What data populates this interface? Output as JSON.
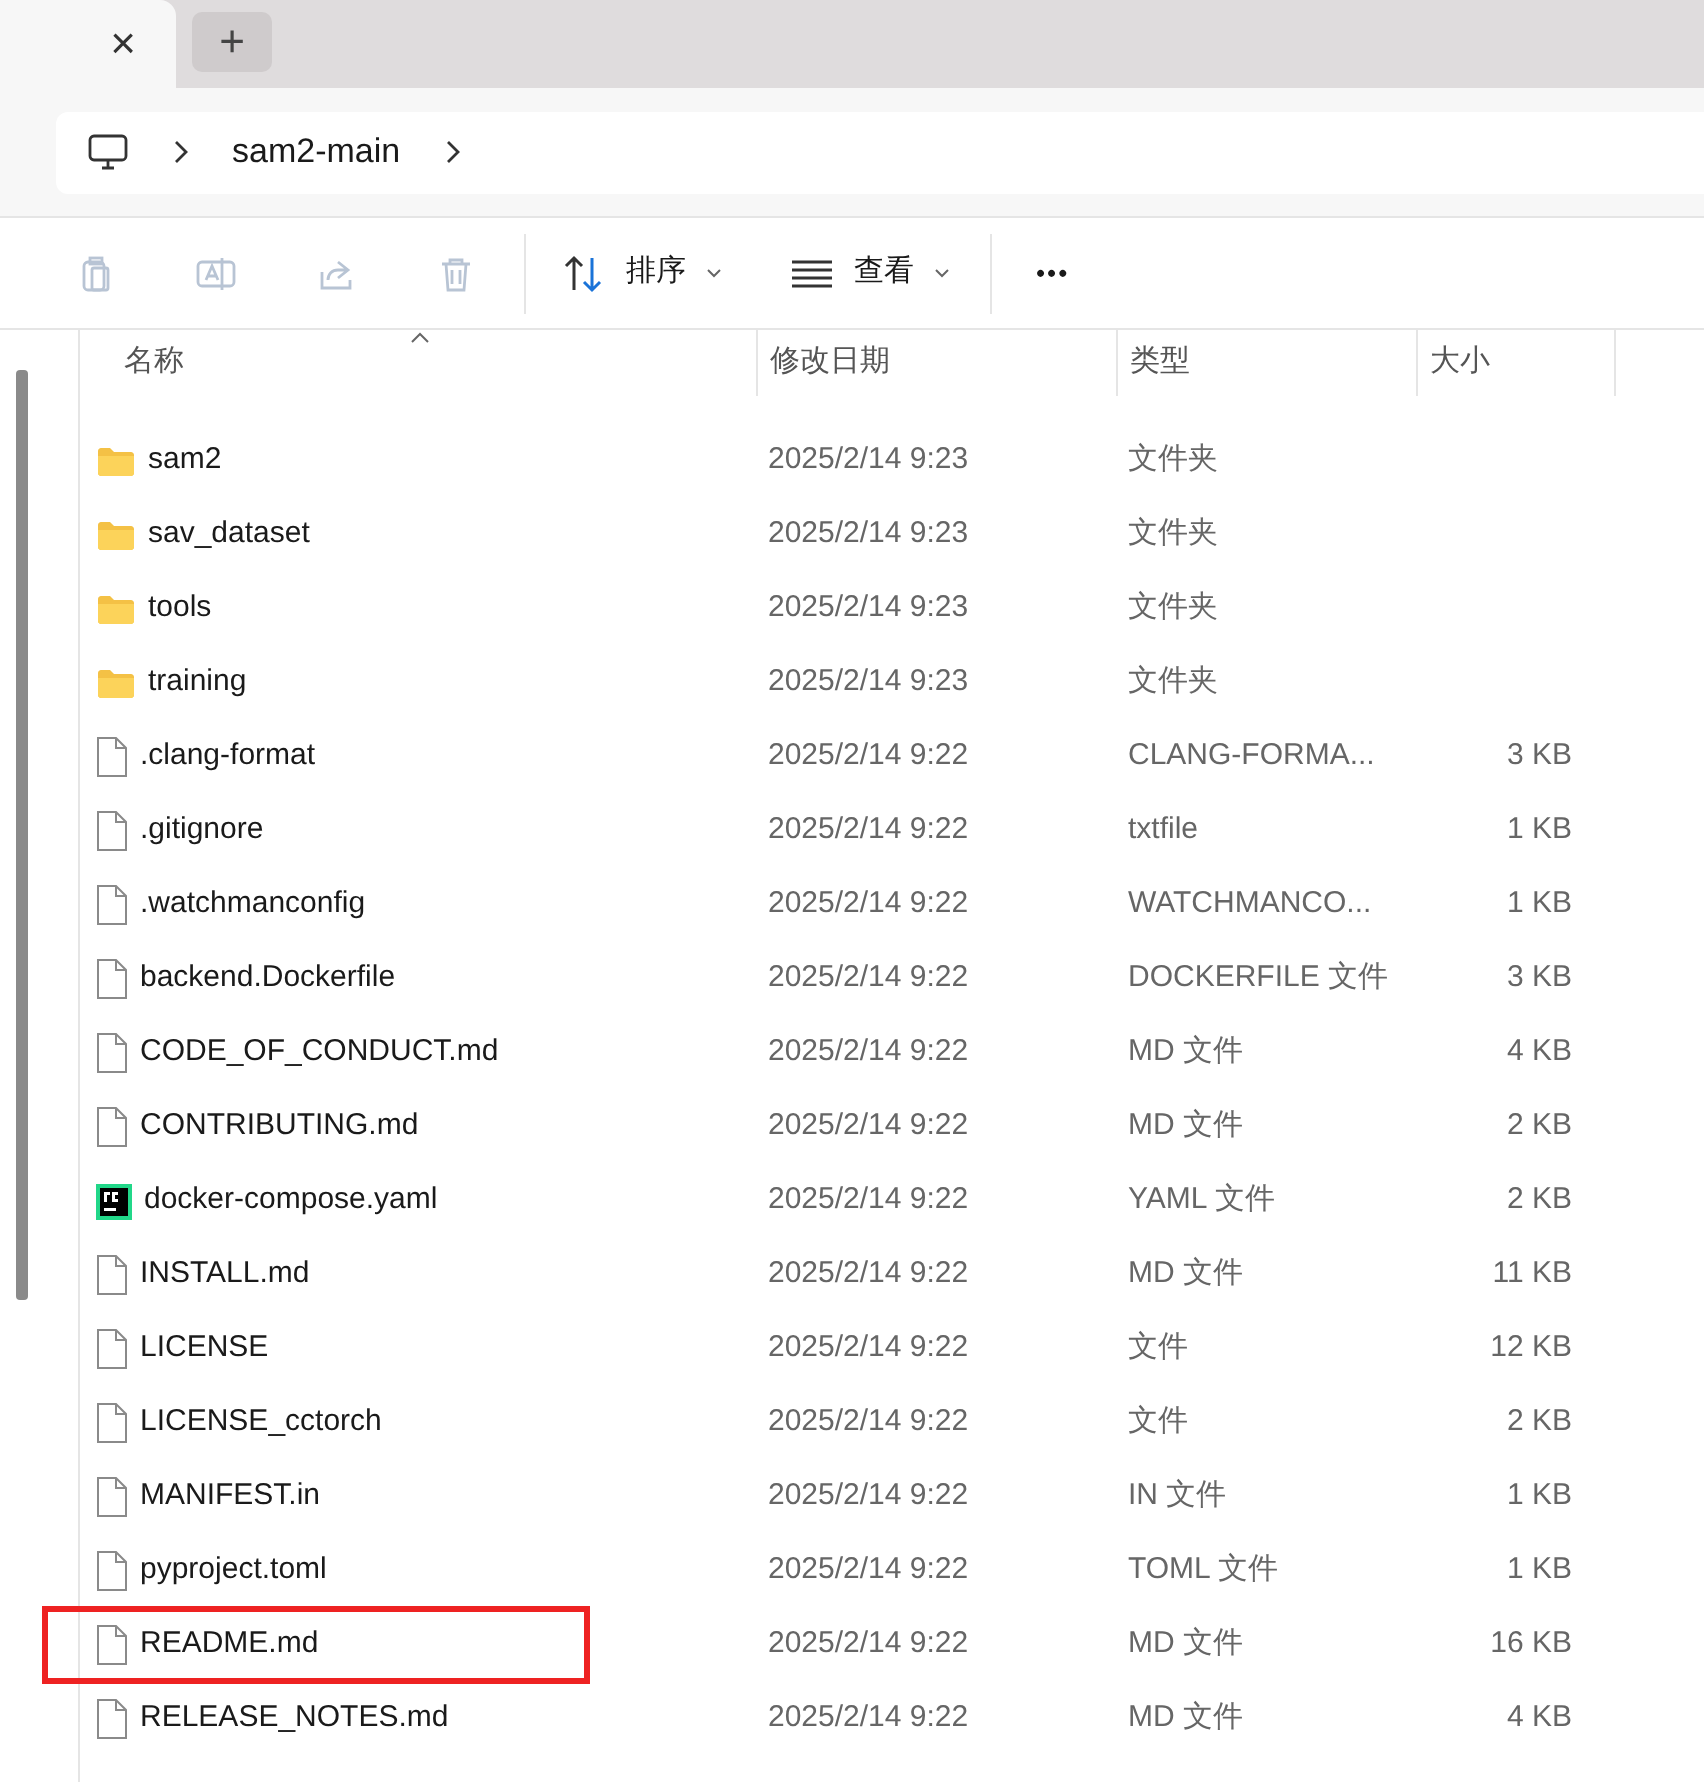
{
  "tab_strip": {
    "close_glyph": "×",
    "new_tab_glyph": "+"
  },
  "address_bar": {
    "crumbs": [
      {
        "label": "sam2-main"
      }
    ]
  },
  "toolbar": {
    "sort": {
      "label": "排序"
    },
    "view": {
      "label": "查看"
    },
    "more": "•••"
  },
  "columns": [
    "名称",
    "修改日期",
    "类型",
    "大小"
  ],
  "rows": [
    {
      "kind": "folder",
      "name": "sam2",
      "date": "2025/2/14 9:23",
      "type": "文件夹",
      "highlighted": false
    },
    {
      "kind": "folder",
      "name": "sav_dataset",
      "date": "2025/2/14 9:23",
      "type": "文件夹",
      "highlighted": false
    },
    {
      "kind": "folder",
      "name": "tools",
      "date": "2025/2/14 9:23",
      "type": "文件夹",
      "highlighted": false
    },
    {
      "kind": "folder",
      "name": "training",
      "date": "2025/2/14 9:23",
      "type": "文件夹",
      "highlighted": false
    },
    {
      "kind": "file",
      "name": ".clang-format",
      "date": "2025/2/14 9:22",
      "type": "CLANG-FORMA...",
      "size": "3 KB",
      "highlighted": false
    },
    {
      "kind": "file",
      "name": ".gitignore",
      "date": "2025/2/14 9:22",
      "type": "txtfile",
      "size": "1 KB",
      "highlighted": false
    },
    {
      "kind": "file",
      "name": ".watchmanconfig",
      "date": "2025/2/14 9:22",
      "type": "WATCHMANCO...",
      "size": "1 KB",
      "highlighted": false
    },
    {
      "kind": "file",
      "name": "backend.Dockerfile",
      "date": "2025/2/14 9:22",
      "type": "DOCKERFILE 文件",
      "size": "3 KB",
      "highlighted": false
    },
    {
      "kind": "file",
      "name": "CODE_OF_CONDUCT.md",
      "date": "2025/2/14 9:22",
      "type": "MD 文件",
      "size": "4 KB",
      "highlighted": false
    },
    {
      "kind": "file",
      "name": "CONTRIBUTING.md",
      "date": "2025/2/14 9:22",
      "type": "MD 文件",
      "size": "2 KB",
      "highlighted": false
    },
    {
      "kind": "app",
      "name": "docker-compose.yaml",
      "date": "2025/2/14 9:22",
      "type": "YAML 文件",
      "size": "2 KB",
      "highlighted": false
    },
    {
      "kind": "file",
      "name": "INSTALL.md",
      "date": "2025/2/14 9:22",
      "type": "MD 文件",
      "size": "11 KB",
      "highlighted": false
    },
    {
      "kind": "file",
      "name": "LICENSE",
      "date": "2025/2/14 9:22",
      "type": "文件",
      "size": "12 KB",
      "highlighted": false
    },
    {
      "kind": "file",
      "name": "LICENSE_cctorch",
      "date": "2025/2/14 9:22",
      "type": "文件",
      "size": "2 KB",
      "highlighted": false
    },
    {
      "kind": "file",
      "name": "MANIFEST.in",
      "date": "2025/2/14 9:22",
      "type": "IN 文件",
      "size": "1 KB",
      "highlighted": false
    },
    {
      "kind": "file",
      "name": "pyproject.toml",
      "date": "2025/2/14 9:22",
      "type": "TOML 文件",
      "size": "1 KB",
      "highlighted": false
    },
    {
      "kind": "file",
      "name": "README.md",
      "date": "2025/2/14 9:22",
      "type": "MD 文件",
      "size": "16 KB",
      "highlighted": true
    },
    {
      "kind": "file",
      "name": "RELEASE_NOTES.md",
      "date": "2025/2/14 9:22",
      "type": "MD 文件",
      "size": "4 KB",
      "highlighted": false
    }
  ]
}
